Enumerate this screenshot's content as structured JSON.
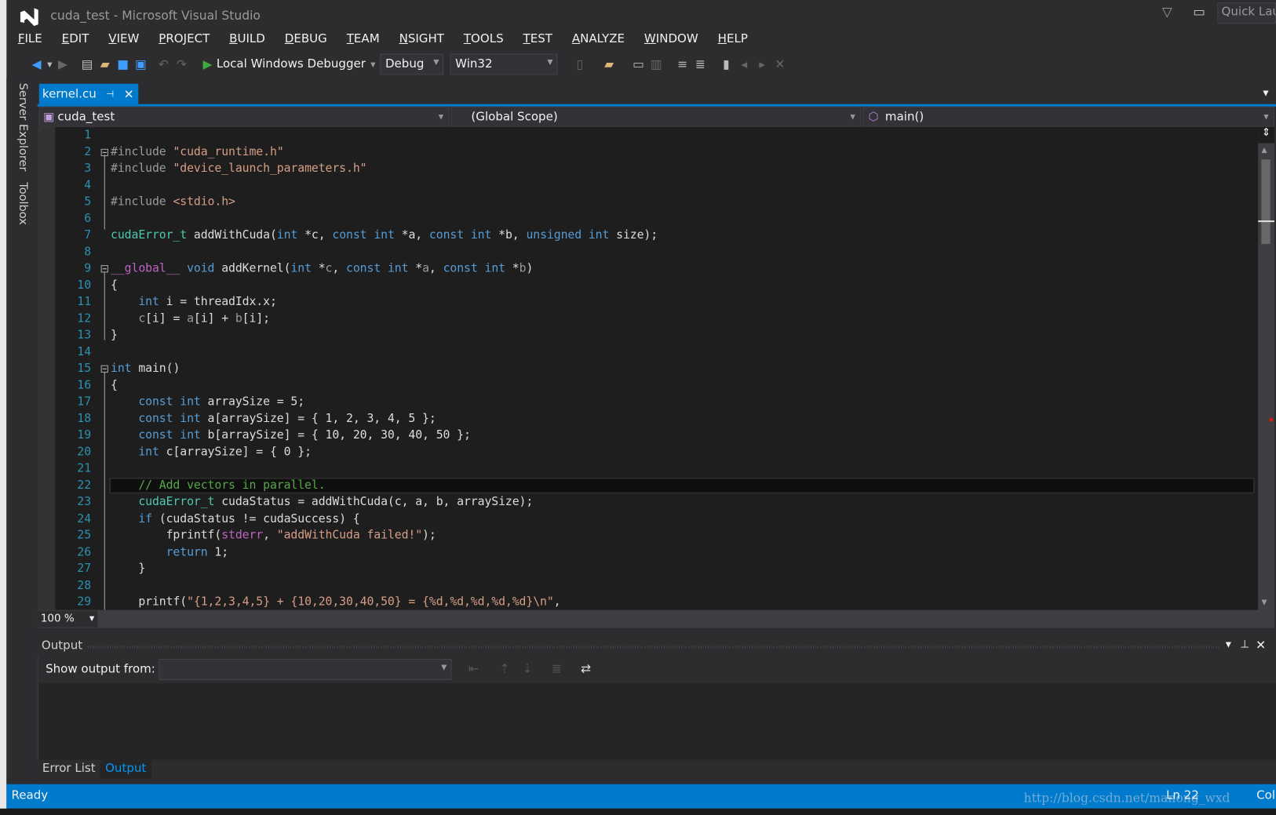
{
  "window": {
    "title": "cuda_test - Microsoft Visual Studio",
    "quick_launch": "Quick Lau"
  },
  "menu": [
    "FILE",
    "EDIT",
    "VIEW",
    "PROJECT",
    "BUILD",
    "DEBUG",
    "TEAM",
    "NSIGHT",
    "TOOLS",
    "TEST",
    "ANALYZE",
    "WINDOW",
    "HELP"
  ],
  "toolbar": {
    "debugger": "Local Windows Debugger",
    "config": "Debug",
    "platform": "Win32"
  },
  "side_tabs": [
    "Server Explorer",
    "Toolbox"
  ],
  "doc_tab": {
    "label": "kernel.cu"
  },
  "nav": {
    "project": "cuda_test",
    "scope": "(Global Scope)",
    "member": "main()"
  },
  "editor": {
    "zoom": "100 %",
    "current_line": 22,
    "lines": [
      [],
      [
        [
          "pp",
          "#include "
        ],
        [
          "st",
          "\"cuda_runtime.h\""
        ]
      ],
      [
        [
          "pp",
          "#include "
        ],
        [
          "st",
          "\"device_launch_parameters.h\""
        ]
      ],
      [],
      [
        [
          "pp",
          "#include "
        ],
        [
          "st",
          "<stdio.h>"
        ]
      ],
      [],
      [
        [
          "ty",
          "cudaError_t"
        ],
        [
          "tx",
          " addWithCuda("
        ],
        [
          "kw",
          "int"
        ],
        [
          "tx",
          " *c, "
        ],
        [
          "kw",
          "const int"
        ],
        [
          "tx",
          " *a, "
        ],
        [
          "kw",
          "const int"
        ],
        [
          "tx",
          " *b, "
        ],
        [
          "kw",
          "unsigned int"
        ],
        [
          "tx",
          " size);"
        ]
      ],
      [],
      [
        [
          "pu",
          "__global__"
        ],
        [
          "tx",
          " "
        ],
        [
          "kw",
          "void"
        ],
        [
          "tx",
          " addKernel("
        ],
        [
          "kw",
          "int"
        ],
        [
          "tx",
          " *"
        ],
        [
          "pa",
          "c"
        ],
        [
          "tx",
          ", "
        ],
        [
          "kw",
          "const int"
        ],
        [
          "tx",
          " *"
        ],
        [
          "pa",
          "a"
        ],
        [
          "tx",
          ", "
        ],
        [
          "kw",
          "const int"
        ],
        [
          "tx",
          " *"
        ],
        [
          "pa",
          "b"
        ],
        [
          "tx",
          ")"
        ]
      ],
      [
        [
          "tx",
          "{"
        ]
      ],
      [
        [
          "tx",
          "    "
        ],
        [
          "kw",
          "int"
        ],
        [
          "tx",
          " i = threadIdx.x;"
        ]
      ],
      [
        [
          "tx",
          "    "
        ],
        [
          "pa",
          "c"
        ],
        [
          "tx",
          "[i] = "
        ],
        [
          "pa",
          "a"
        ],
        [
          "tx",
          "[i] + "
        ],
        [
          "pa",
          "b"
        ],
        [
          "tx",
          "[i];"
        ]
      ],
      [
        [
          "tx",
          "}"
        ]
      ],
      [],
      [
        [
          "kw",
          "int"
        ],
        [
          "tx",
          " main()"
        ]
      ],
      [
        [
          "tx",
          "{"
        ]
      ],
      [
        [
          "tx",
          "    "
        ],
        [
          "kw",
          "const int"
        ],
        [
          "tx",
          " arraySize = 5;"
        ]
      ],
      [
        [
          "tx",
          "    "
        ],
        [
          "kw",
          "const int"
        ],
        [
          "tx",
          " a[arraySize] = { 1, 2, 3, 4, 5 };"
        ]
      ],
      [
        [
          "tx",
          "    "
        ],
        [
          "kw",
          "const int"
        ],
        [
          "tx",
          " b[arraySize] = { 10, 20, 30, 40, 50 };"
        ]
      ],
      [
        [
          "tx",
          "    "
        ],
        [
          "kw",
          "int"
        ],
        [
          "tx",
          " c[arraySize] = { 0 };"
        ]
      ],
      [],
      [
        [
          "tx",
          "    "
        ],
        [
          "cm",
          "// Add vectors in parallel."
        ]
      ],
      [
        [
          "tx",
          "    "
        ],
        [
          "ty",
          "cudaError_t"
        ],
        [
          "tx",
          " cudaStatus = addWithCuda(c, a, b, arraySize);"
        ]
      ],
      [
        [
          "tx",
          "    "
        ],
        [
          "kw",
          "if"
        ],
        [
          "tx",
          " (cudaStatus != cudaSuccess) {"
        ]
      ],
      [
        [
          "tx",
          "        fprintf("
        ],
        [
          "pu",
          "stderr"
        ],
        [
          "tx",
          ", "
        ],
        [
          "st",
          "\"addWithCuda failed!\""
        ],
        [
          "tx",
          ");"
        ]
      ],
      [
        [
          "tx",
          "        "
        ],
        [
          "kw",
          "return"
        ],
        [
          "tx",
          " 1;"
        ]
      ],
      [
        [
          "tx",
          "    }"
        ]
      ],
      [],
      [
        [
          "tx",
          "    printf("
        ],
        [
          "st",
          "\"{1,2,3,4,5} + {10,20,30,40,50} = {%d,%d,%d,%d,%d}\\n\""
        ],
        [
          "tx",
          ","
        ]
      ]
    ]
  },
  "output": {
    "title": "Output",
    "show_from_label": "Show output from:",
    "show_from_value": ""
  },
  "bottom_tabs": [
    "Error List",
    "Output"
  ],
  "status": {
    "text": "Ready",
    "ln": "Ln 22",
    "col": "Col",
    "watermark": "http://blog.csdn.net/manong_wxd"
  },
  "colors": {
    "accent": "#007acc",
    "keyword": "#569cd6",
    "type": "#4ec9b0",
    "string": "#d69d85",
    "comment": "#57a64a",
    "line_number": "#2b91af"
  }
}
